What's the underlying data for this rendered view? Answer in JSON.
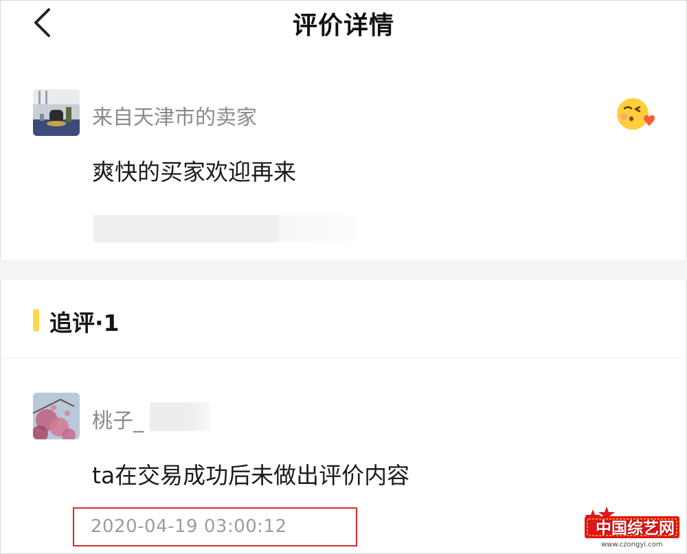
{
  "header": {
    "title": "评价详情"
  },
  "review": {
    "seller_label": "来自天津市的卖家",
    "content": "爽快的买家欢迎再来"
  },
  "follow_up": {
    "section_title": "追评·1",
    "user_name": "桃子_",
    "content": "ta在交易成功后未做出评价内容",
    "timestamp": "2020-04-19 03:00:12"
  },
  "watermark": {
    "brand": "中国综艺网",
    "url": "www.czongyi.com"
  },
  "colors": {
    "accent_bar": "#f9d94b",
    "highlight_box": "#d72a2a",
    "divider_band": "#f3f4f6"
  }
}
